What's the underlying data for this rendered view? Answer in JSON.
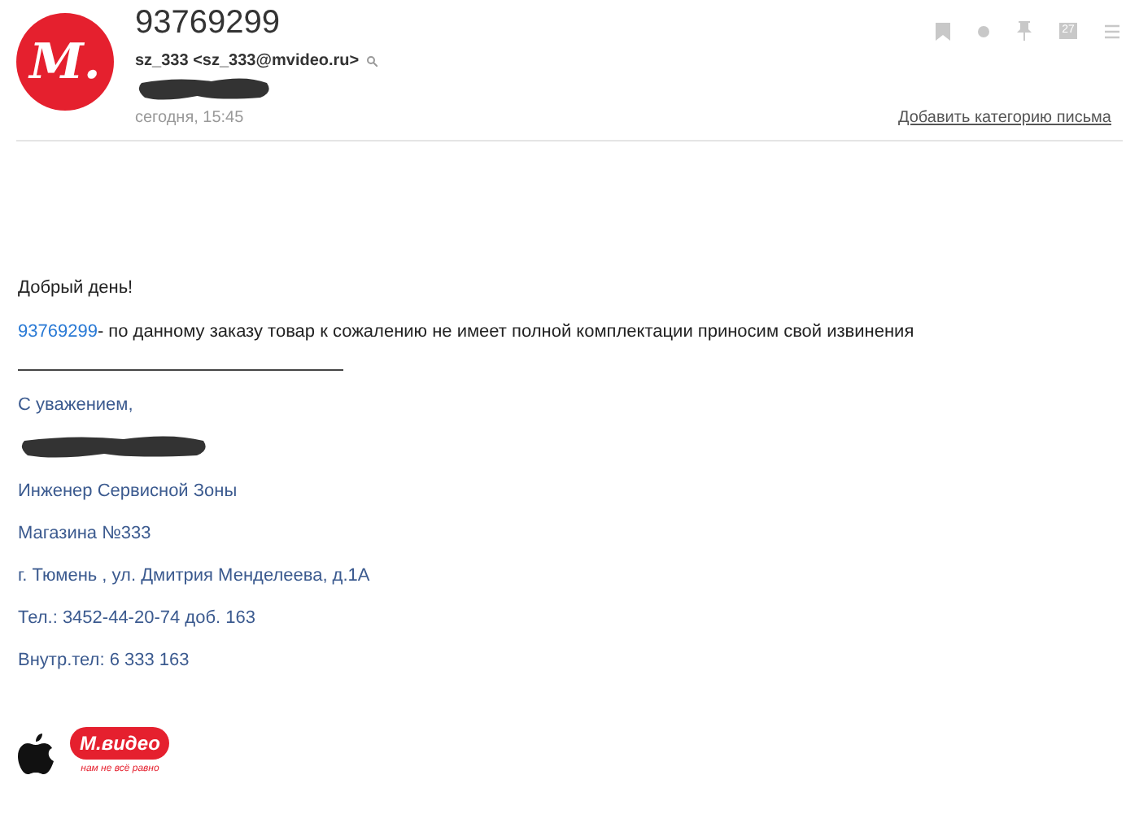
{
  "header": {
    "avatar_letter": "М.",
    "subject": "93769299",
    "sender": "sz_333 <sz_333@mvideo.ru>",
    "date": "сегодня, 15:45",
    "calendar_day": "27",
    "category_link": "Добавить категорию письма"
  },
  "body": {
    "greeting": "Добрый день!",
    "order_link": "93769299",
    "message": "- по данному заказу товар к сожалению не имеет полной комплектации приносим свой извинения",
    "closing": "С уважением,",
    "signature": [
      "Инженер Сервисной Зоны",
      "Магазина №333",
      "г. Тюмень , ул. Дмитрия Менделеева, д.1А",
      "Тел.: 3452-44-20-74  доб. 163",
      "Внутр.тел: 6 333 163"
    ]
  },
  "footer": {
    "logo_text": "М.видео",
    "slogan": "нам не всё равно"
  }
}
